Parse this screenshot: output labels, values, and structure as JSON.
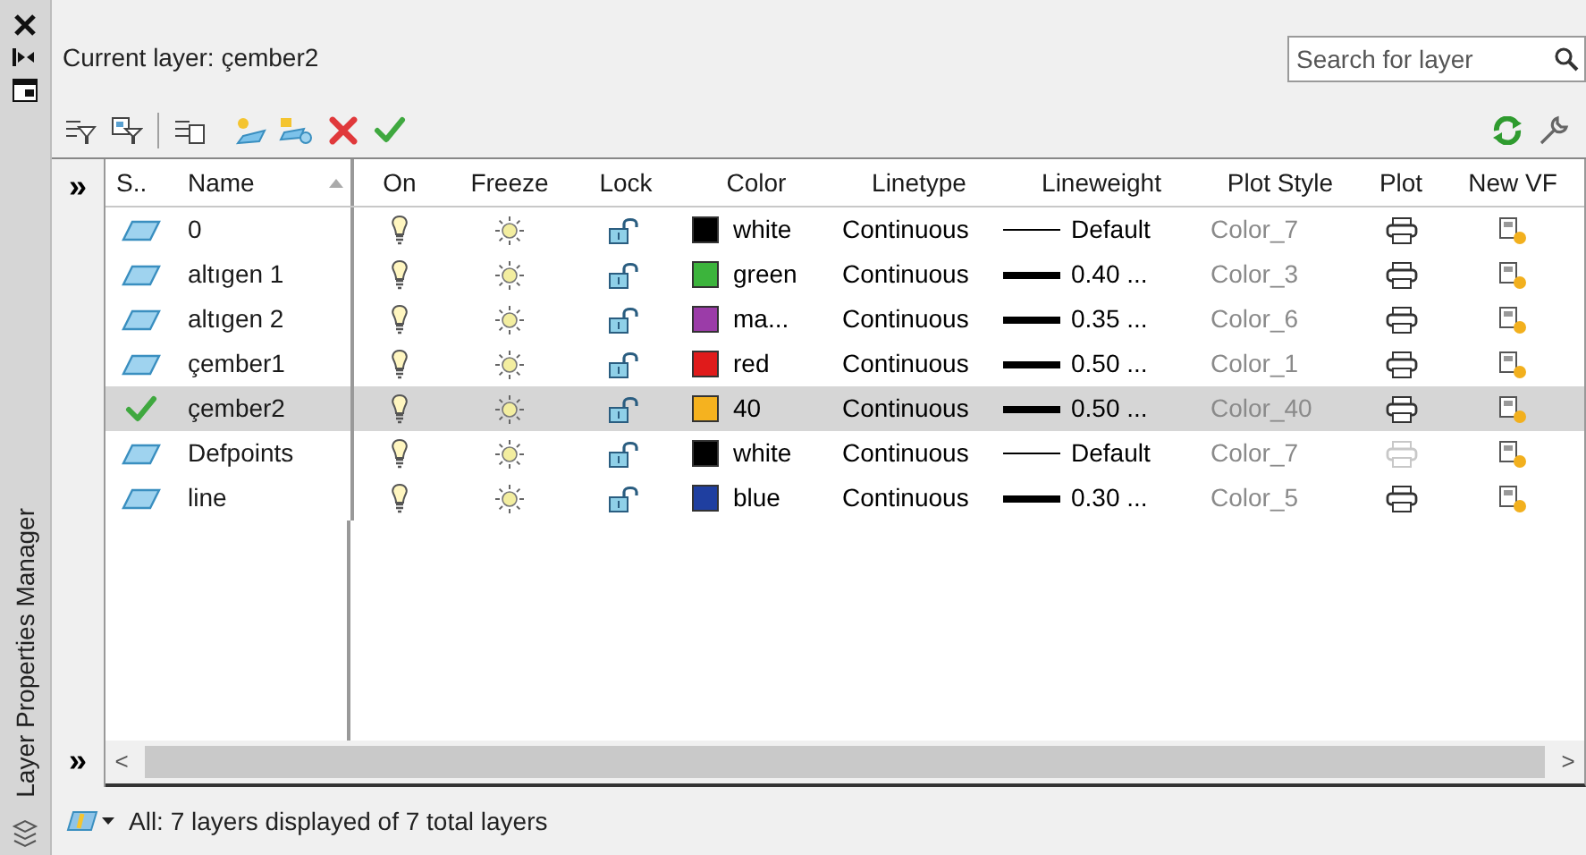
{
  "side_panel": {
    "title": "Layer Properties Manager"
  },
  "header": {
    "current_layer": "Current layer: çember2",
    "search": {
      "placeholder": "Search for layer"
    }
  },
  "table": {
    "columns": [
      "S..",
      "Name",
      "On",
      "Freeze",
      "Lock",
      "Color",
      "Linetype",
      "Lineweight",
      "Plot Style",
      "Plot",
      "New VF"
    ],
    "rows": [
      {
        "current": false,
        "selected": false,
        "name": "0",
        "color_name": "white",
        "color": "#000000",
        "linetype": "Continuous",
        "thick_line": false,
        "lineweight": "Default",
        "plot_style": "Color_7",
        "plot": true
      },
      {
        "current": false,
        "selected": false,
        "name": "altıgen 1",
        "color_name": "green",
        "color": "#3cb43c",
        "linetype": "Continuous",
        "thick_line": true,
        "lineweight": "0.40 ...",
        "plot_style": "Color_3",
        "plot": true
      },
      {
        "current": false,
        "selected": false,
        "name": "altıgen 2",
        "color_name": "ma...",
        "color": "#9b3ca8",
        "linetype": "Continuous",
        "thick_line": true,
        "lineweight": "0.35 ...",
        "plot_style": "Color_6",
        "plot": true
      },
      {
        "current": false,
        "selected": false,
        "name": "çember1",
        "color_name": "red",
        "color": "#e01b1b",
        "linetype": "Continuous",
        "thick_line": true,
        "lineweight": "0.50 ...",
        "plot_style": "Color_1",
        "plot": true
      },
      {
        "current": true,
        "selected": true,
        "name": "çember2",
        "color_name": "40",
        "color": "#f5b21f",
        "linetype": "Continuous",
        "thick_line": true,
        "lineweight": "0.50 ...",
        "plot_style": "Color_40",
        "plot": true
      },
      {
        "current": false,
        "selected": false,
        "name": "Defpoints",
        "color_name": "white",
        "color": "#000000",
        "linetype": "Continuous",
        "thick_line": false,
        "lineweight": "Default",
        "plot_style": "Color_7",
        "plot": false
      },
      {
        "current": false,
        "selected": false,
        "name": "line",
        "color_name": "blue",
        "color": "#1f3fa0",
        "linetype": "Continuous",
        "thick_line": true,
        "lineweight": "0.30 ...",
        "plot_style": "Color_5",
        "plot": true
      }
    ]
  },
  "gutter": {
    "expand_top": "»",
    "expand_bottom": "»"
  },
  "scrollbar": {
    "left": "<",
    "right": ">"
  },
  "status_bar": {
    "text": "All: 7 layers displayed of 7 total layers"
  }
}
